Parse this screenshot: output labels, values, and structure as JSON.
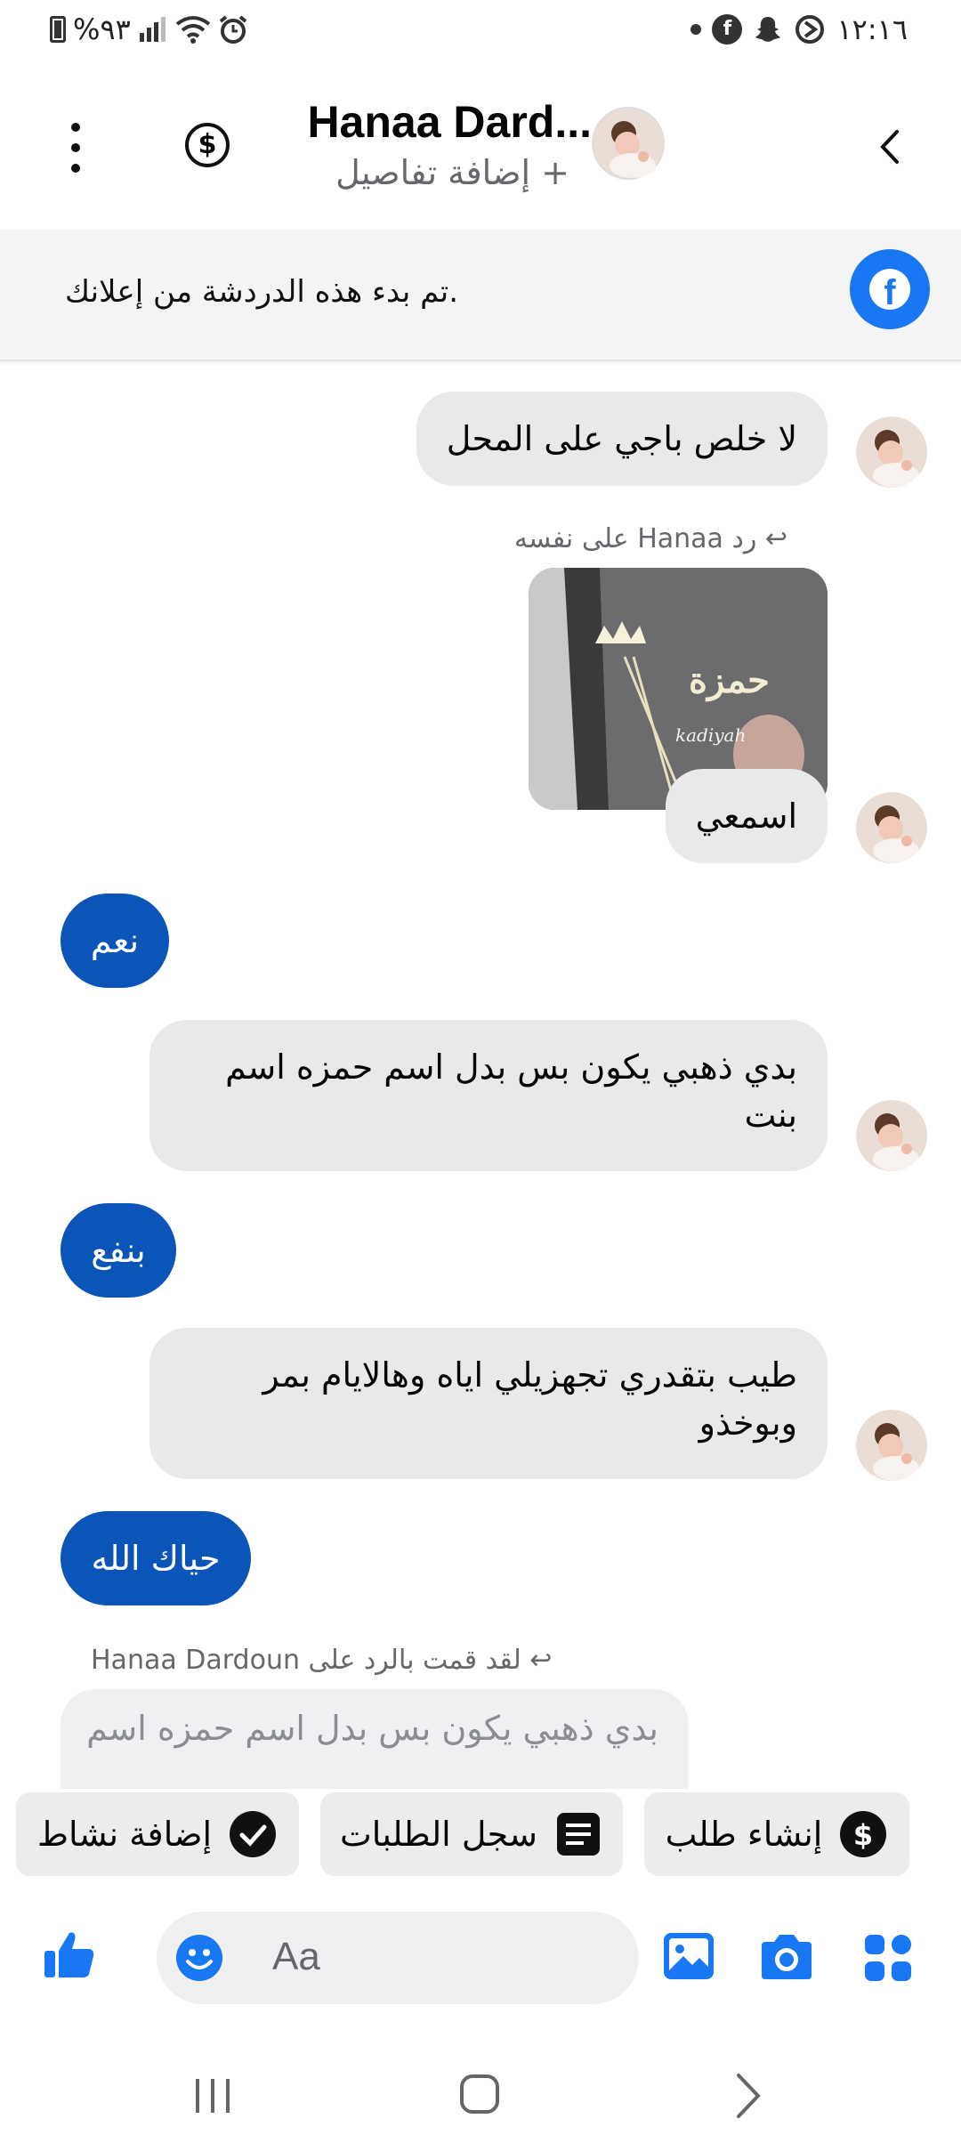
{
  "status_bar": {
    "time": "١٢:١٦",
    "battery": "%٩٣",
    "icons": [
      "alarm-icon",
      "wifi-icon",
      "signal-icon",
      "battery-icon",
      "data-saver-icon",
      "snapchat-icon",
      "facebook-icon",
      "dot-icon"
    ]
  },
  "header": {
    "title": "Hanaa Dard...",
    "subtitle": "+ إضافة تفاصيل"
  },
  "banner": {
    "text": ".تم بدء هذه الدردشة من إعلانك"
  },
  "messages": [
    {
      "type": "in",
      "text": "لا خلص باجي على المحل"
    },
    {
      "type": "in_reply_meta",
      "text": "رد Hanaa على نفسه"
    },
    {
      "type": "in",
      "text": "اسمعي"
    },
    {
      "type": "out",
      "text": "نعم"
    },
    {
      "type": "in",
      "text": "بدي ذهبي يكون بس بدل اسم حمزه اسم بنت"
    },
    {
      "type": "out",
      "text": "بنفع"
    },
    {
      "type": "in",
      "text": "طيب بتقدري تجهزيلي اياه وهالايام بمر وبوخذو"
    },
    {
      "type": "out",
      "text": "حياك الله"
    },
    {
      "type": "out_reply_meta",
      "text": "لقد قمت بالرد على Hanaa Dardoun"
    },
    {
      "type": "quoted",
      "text": "بدي ذهبي يكون بس بدل اسم حمزه اسم"
    }
  ],
  "photo": {
    "script_text": "حمزة",
    "watermark": "kadiyah"
  },
  "chips": [
    {
      "label": "إنشاء طلب",
      "icon": "dollar-icon"
    },
    {
      "label": "سجل الطلبات",
      "icon": "list-icon"
    },
    {
      "label": "إضافة نشاط",
      "icon": "check-icon"
    }
  ],
  "composer": {
    "placeholder": "Aa"
  },
  "colors": {
    "accent": "#1877f2",
    "outgoing_bubble": "#0b55b8",
    "incoming_bubble": "#e9e9eb"
  }
}
